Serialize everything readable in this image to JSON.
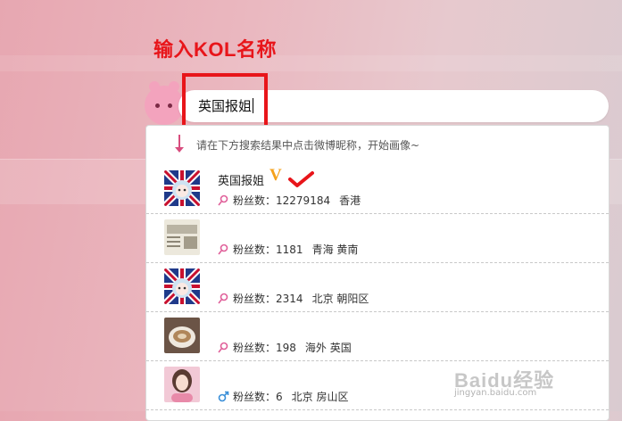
{
  "annotation": {
    "title": "输入KOL名称"
  },
  "search": {
    "value": "英国报姐"
  },
  "dropdown": {
    "hint": "请在下方搜索结果中点击微博昵称，开始画像~",
    "fans_label": "粉丝数：",
    "results": [
      {
        "name": "英国报姐",
        "verified": "V",
        "gender": "female",
        "fans": "12279184",
        "region1": "香港",
        "region2": "",
        "avatar": "union-jack-cartoon"
      },
      {
        "name": "",
        "verified": "",
        "gender": "female",
        "fans": "1181",
        "region1": "青海",
        "region2": "黄南",
        "avatar": "newspaper"
      },
      {
        "name": "",
        "verified": "",
        "gender": "female",
        "fans": "2314",
        "region1": "北京",
        "region2": "朝阳区",
        "avatar": "union-jack-cartoon"
      },
      {
        "name": "",
        "verified": "",
        "gender": "female",
        "fans": "198",
        "region1": "海外",
        "region2": "英国",
        "avatar": "coffee-cup"
      },
      {
        "name": "",
        "verified": "",
        "gender": "male",
        "fans": "6",
        "region1": "北京",
        "region2": "房山区",
        "avatar": "portrait"
      }
    ]
  },
  "colors": {
    "annotation_red": "#e8151a",
    "verified_orange": "#f5a11a",
    "female_pink": "#e0609a",
    "male_blue": "#3a8fd8"
  },
  "watermark": {
    "logo": "Baidu经验",
    "sub": "jingyan.baidu.com"
  }
}
